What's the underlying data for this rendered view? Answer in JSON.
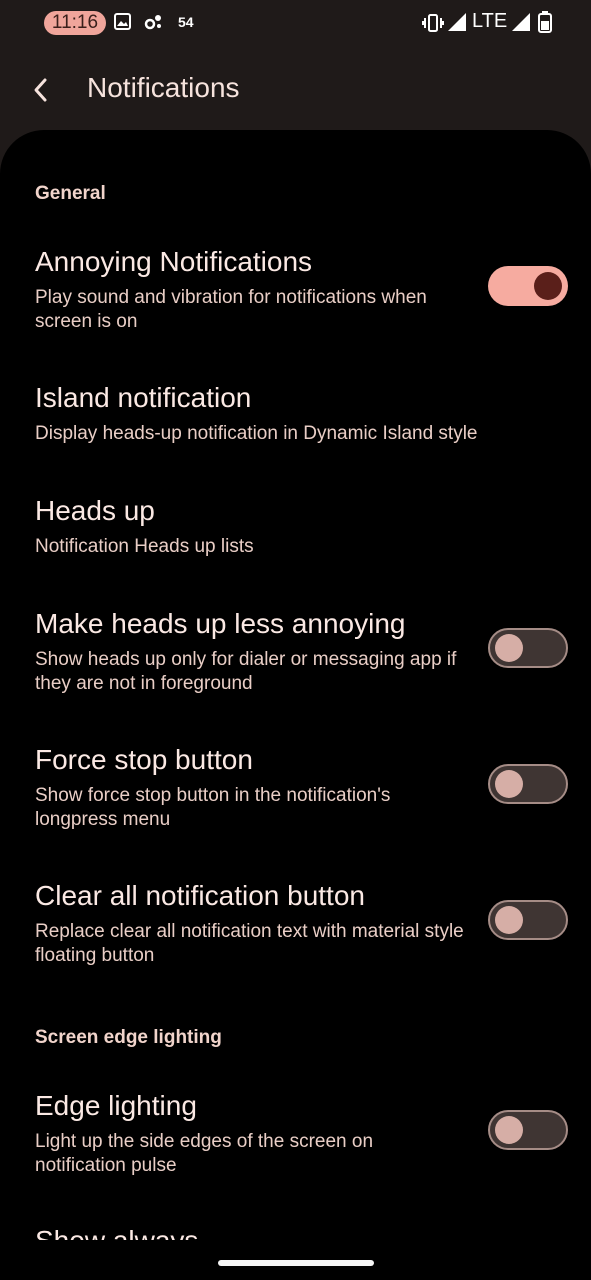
{
  "status_bar": {
    "time": "11:16",
    "notification_count": "54",
    "network": "LTE"
  },
  "app_bar": {
    "title": "Notifications"
  },
  "sections": {
    "general": "General",
    "edge": "Screen edge lighting"
  },
  "prefs": {
    "annoying": {
      "title": "Annoying Notifications",
      "summary": "Play sound and vibration for notifications when screen is on",
      "enabled": true
    },
    "island": {
      "title": "Island notification",
      "summary": "Display heads-up notification in Dynamic Island style"
    },
    "heads_up": {
      "title": "Heads up",
      "summary": "Notification Heads up lists"
    },
    "less_annoying": {
      "title": "Make heads up less annoying",
      "summary": "Show heads up only for dialer or messaging app if they are not in foreground",
      "enabled": false
    },
    "force_stop": {
      "title": "Force stop button",
      "summary": "Show force stop button in the notification's longpress menu",
      "enabled": false
    },
    "clear_all": {
      "title": "Clear all notification button",
      "summary": "Replace clear all notification text with material style floating button",
      "enabled": false
    },
    "edge_lighting": {
      "title": "Edge lighting",
      "summary": "Light up the side edges of the screen on notification pulse",
      "enabled": false
    },
    "show_always": {
      "title": "Show always"
    }
  },
  "colors": {
    "accent": "#f6aba0",
    "background": "#000000",
    "toolbar": "#1f1a19"
  }
}
